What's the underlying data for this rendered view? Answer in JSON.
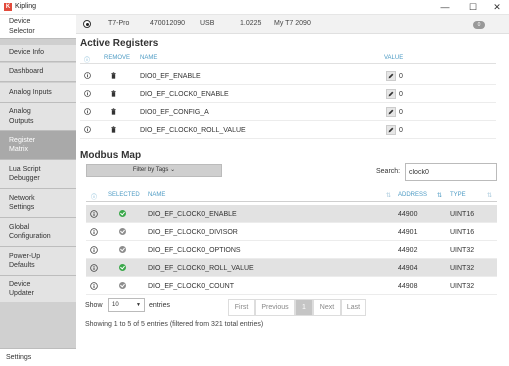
{
  "window": {
    "app_icon": "K",
    "title": "Kipling",
    "controls": {
      "minimize": "—",
      "maximize": "☐",
      "close": "✕"
    }
  },
  "sidebar": {
    "items": [
      {
        "label": "Device Selector",
        "lines": [
          "Device",
          "Selector"
        ]
      },
      {
        "label": "Device Info",
        "lines": [
          "Device Info"
        ]
      },
      {
        "label": "Dashboard",
        "lines": [
          "Dashboard"
        ]
      },
      {
        "label": "Analog Inputs",
        "lines": [
          "Analog Inputs"
        ]
      },
      {
        "label": "Analog Outputs",
        "lines": [
          "Analog",
          "Outputs"
        ]
      },
      {
        "label": "Register Matrix",
        "lines": [
          "Register",
          "Matrix"
        ],
        "active": true
      },
      {
        "label": "Lua Script Debugger",
        "lines": [
          "Lua Script",
          "Debugger"
        ]
      },
      {
        "label": "Network Settings",
        "lines": [
          "Network",
          "Settings"
        ]
      },
      {
        "label": "Global Configuration",
        "lines": [
          "Global",
          "Configuration"
        ]
      },
      {
        "label": "Power-Up Defaults",
        "lines": [
          "Power-Up",
          "Defaults"
        ]
      },
      {
        "label": "Device Updater",
        "lines": [
          "Device",
          "Updater"
        ]
      }
    ],
    "settings_label": "Settings"
  },
  "device": {
    "model": "T7-Pro",
    "serial": "470012090",
    "connection": "USB",
    "firmware": "1.0225",
    "name": "My T7 2090",
    "count_badge": "0"
  },
  "active_registers": {
    "title": "Active Registers",
    "headers": {
      "info": "ⓘ",
      "remove": "REMOVE",
      "name": "NAME",
      "value": "VALUE"
    },
    "rows": [
      {
        "name": "DIO0_EF_ENABLE",
        "value": "0"
      },
      {
        "name": "DIO_EF_CLOCK0_ENABLE",
        "value": "0"
      },
      {
        "name": "DIO0_EF_CONFIG_A",
        "value": "0"
      },
      {
        "name": "DIO_EF_CLOCK0_ROLL_VALUE",
        "value": "0"
      }
    ]
  },
  "modbus_map": {
    "title": "Modbus Map",
    "filter_button": "Filter by Tags",
    "search_label": "Search:",
    "search_value": "clock0",
    "headers": {
      "info": "ⓘ",
      "selected": "SELECTED",
      "name": "NAME",
      "address": "ADDRESS",
      "type": "TYPE"
    },
    "rows": [
      {
        "name": "DIO_EF_CLOCK0_ENABLE",
        "address": "44900",
        "type": "UINT16",
        "selected": true
      },
      {
        "name": "DIO_EF_CLOCK0_DIVISOR",
        "address": "44901",
        "type": "UINT16",
        "selected": false
      },
      {
        "name": "DIO_EF_CLOCK0_OPTIONS",
        "address": "44902",
        "type": "UINT32",
        "selected": false
      },
      {
        "name": "DIO_EF_CLOCK0_ROLL_VALUE",
        "address": "44904",
        "type": "UINT32",
        "selected": true
      },
      {
        "name": "DIO_EF_CLOCK0_COUNT",
        "address": "44908",
        "type": "UINT32",
        "selected": false
      }
    ],
    "show_label": "Show",
    "page_size": "10",
    "entries_label": "entries",
    "pagination": {
      "first": "First",
      "previous": "Previous",
      "current": "1",
      "next": "Next",
      "last": "Last"
    },
    "summary": "Showing 1 to 5 of 5 entries (filtered from 321 total entries)"
  },
  "colors": {
    "accent": "#4d9bc4",
    "selected_green": "#3aa84a",
    "unselected_gray": "#8d8d8d",
    "sidebar_active": "#a9a9a9"
  }
}
